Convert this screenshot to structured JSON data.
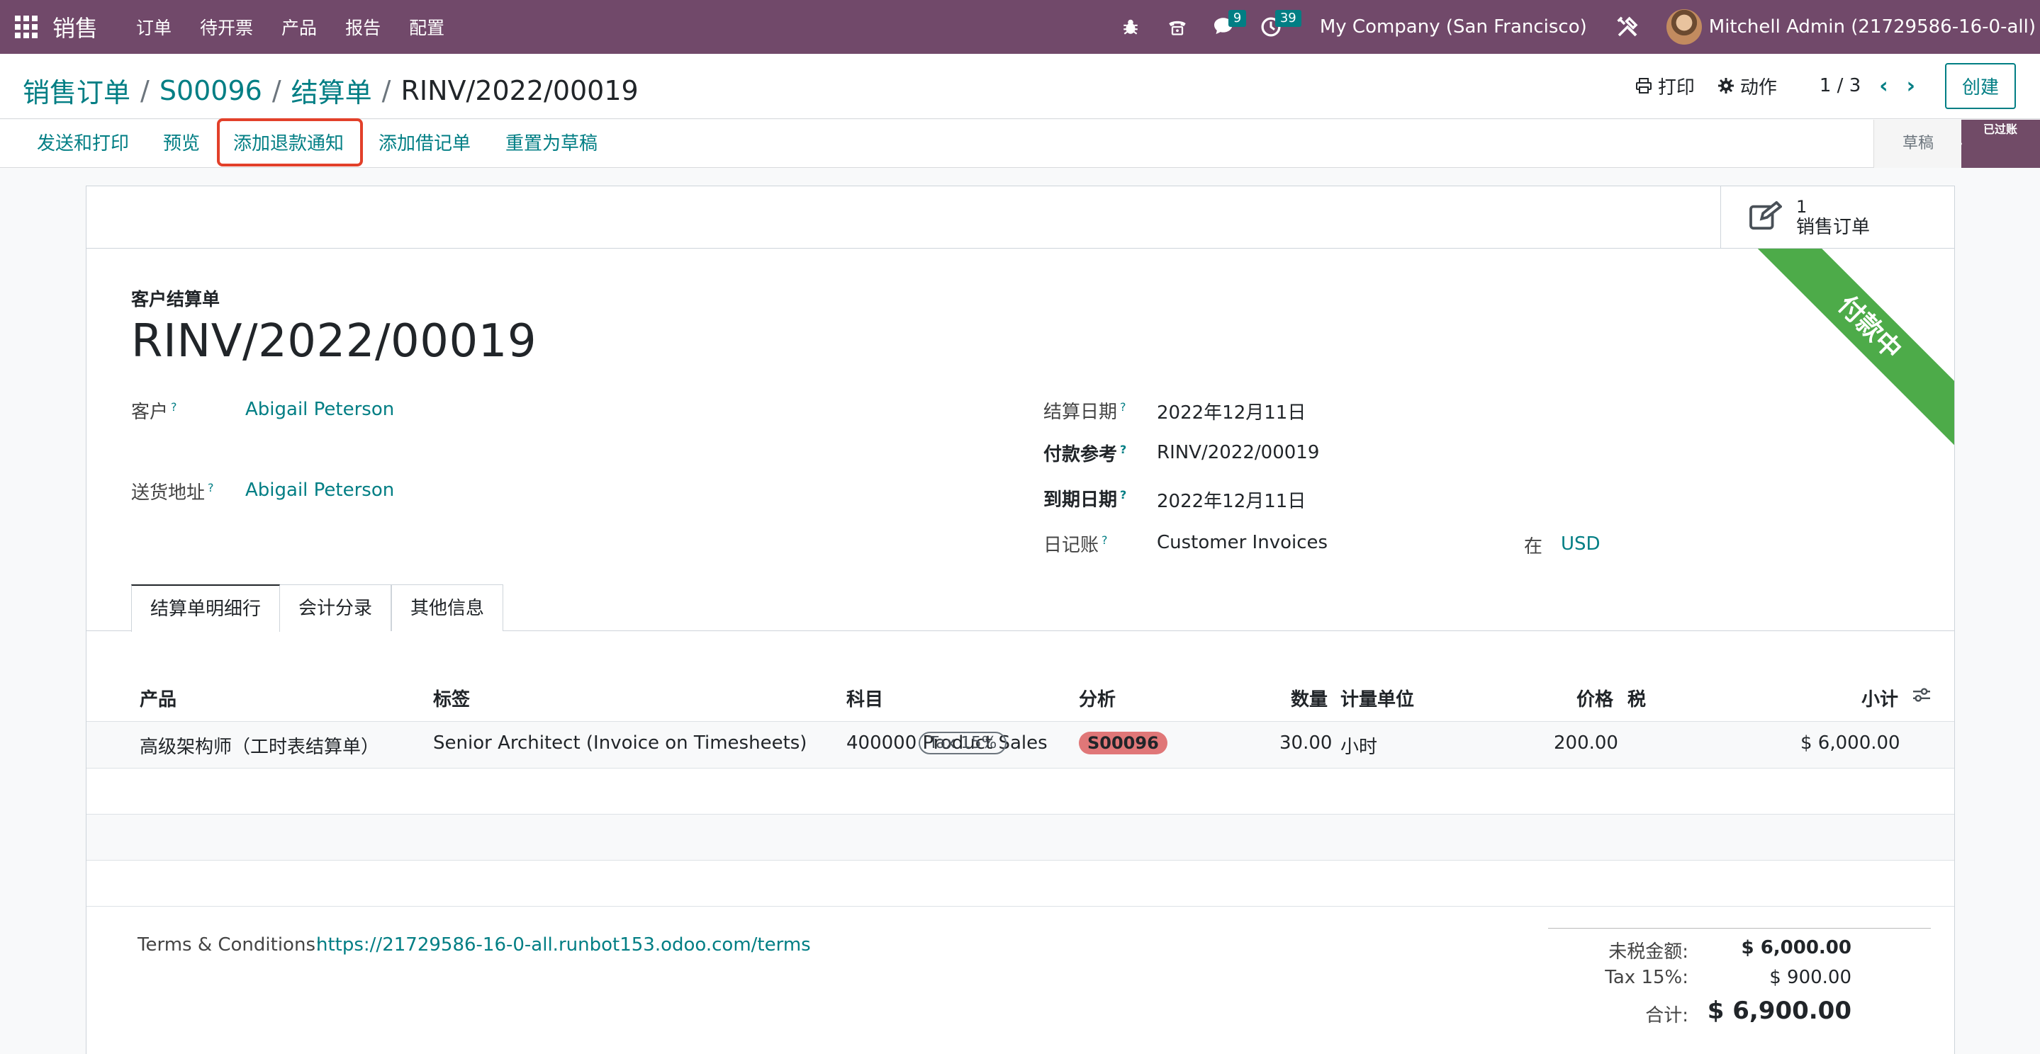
{
  "navbar": {
    "brand": "销售",
    "menu": [
      "订单",
      "待开票",
      "产品",
      "报告",
      "配置"
    ],
    "messages_badge": "9",
    "activities_badge": "39",
    "company": "My Company (San Francisco)",
    "user": "Mitchell Admin (21729586-16-0-all)"
  },
  "breadcrumb": {
    "items": [
      "销售订单",
      "S00096",
      "结算单"
    ],
    "current": "RINV/2022/00019"
  },
  "control": {
    "print": "打印",
    "action": "动作",
    "pager": "1 / 3",
    "create": "创建"
  },
  "statusbar": {
    "buttons": [
      "发送和打印",
      "预览",
      "添加退款通知",
      "添加借记单",
      "重置为草稿"
    ],
    "stages": [
      "草稿",
      "已过账"
    ]
  },
  "smart_button": {
    "count": "1",
    "label": "销售订单"
  },
  "ribbon": "付款中",
  "form": {
    "doc_type": "客户结算单",
    "name": "RINV/2022/00019",
    "customer_label": "客户",
    "customer": "Abigail Peterson",
    "delivery_label": "送货地址",
    "delivery": "Abigail Peterson",
    "invoice_date_label": "结算日期",
    "invoice_date": "2022年12月11日",
    "payment_ref_label": "付款参考",
    "payment_ref": "RINV/2022/00019",
    "due_date_label": "到期日期",
    "due_date": "2022年12月11日",
    "journal_label": "日记账",
    "journal": "Customer Invoices",
    "in_label": "在",
    "currency": "USD"
  },
  "tabs": [
    "结算单明细行",
    "会计分录",
    "其他信息"
  ],
  "table": {
    "headers": [
      "产品",
      "标签",
      "科目",
      "分析",
      "数量",
      "计量单位",
      "价格",
      "税",
      "小计"
    ],
    "rows": [
      {
        "product": "高级架构师（工时表结算单）",
        "label": "Senior Architect (Invoice on Timesheets)",
        "account": "400000 Product Sales",
        "analytic": "S00096",
        "qty": "30.00",
        "uom": "小时",
        "price": "200.00",
        "tax": "Tax 15%",
        "subtotal": "$ 6,000.00"
      }
    ]
  },
  "footer": {
    "terms_label": "Terms & Conditions:",
    "terms_link": "https://21729586-16-0-all.runbot153.odoo.com/terms",
    "untaxed_label": "未税金额:",
    "untaxed": "$ 6,000.00",
    "tax_label": "Tax 15%:",
    "tax": "$ 900.00",
    "total_label": "合计:",
    "total": "$ 6,900.00"
  },
  "colors": {
    "navbar": "#71496a",
    "link": "#017e84",
    "highlight": "#e2402a",
    "ribbon": "#4dab49"
  }
}
